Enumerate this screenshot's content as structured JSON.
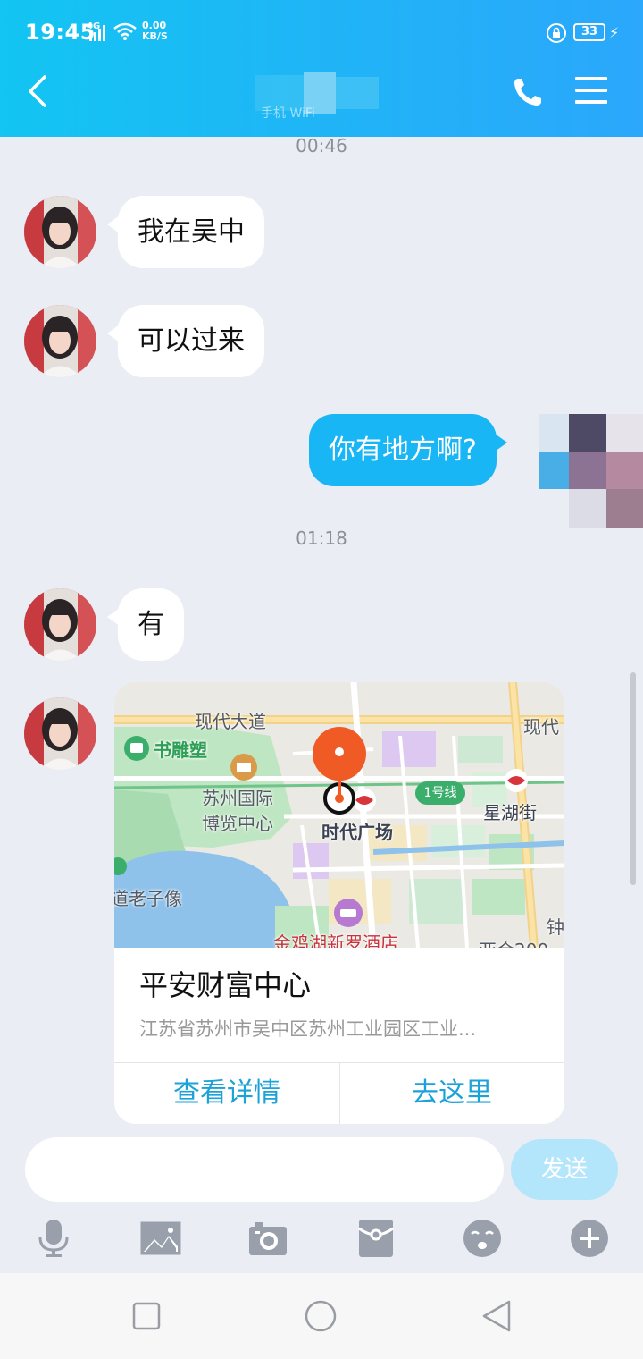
{
  "status_bar": {
    "time": "19:45",
    "network": "4G",
    "speed_value": "0.00",
    "speed_unit": "KB/S",
    "battery": "33"
  },
  "header": {
    "contact_subtitle": "手机 WiFi"
  },
  "messages": [
    {
      "type": "timestamp",
      "text": "00:46"
    },
    {
      "side": "left",
      "text": "我在吴中"
    },
    {
      "side": "left",
      "text": "可以过来"
    },
    {
      "side": "right",
      "text": "你有地方啊?"
    },
    {
      "type": "timestamp",
      "text": "01:18"
    },
    {
      "side": "left",
      "text": "有"
    }
  ],
  "location_card": {
    "place_name": "平安财富中心",
    "address": "江苏省苏州市吴中区苏州工业园区工业...",
    "detail_button": "查看详情",
    "navigate_button": "去这里",
    "map_labels": {
      "road_1": "现代大道",
      "road_2": "现代",
      "poi_1": "书雕塑",
      "poi_2_line1": "苏州国际",
      "poi_2_line2": "博览中心",
      "poi_3": "时代广场",
      "metro_line": "1号线",
      "poi_4": "星湖街",
      "poi_5": "道老子像",
      "poi_6": "金鸡湖新罗酒店",
      "poi_7": "钟",
      "poi_8": "亚合200"
    }
  },
  "composer": {
    "input_value": "",
    "send_label": "发送"
  },
  "colors": {
    "header_start": "#12c5f2",
    "header_end": "#2ba7fb",
    "outgoing_bubble": "#19b6f6",
    "link_blue": "#1ba2d8",
    "pin_red": "#f05a24"
  }
}
